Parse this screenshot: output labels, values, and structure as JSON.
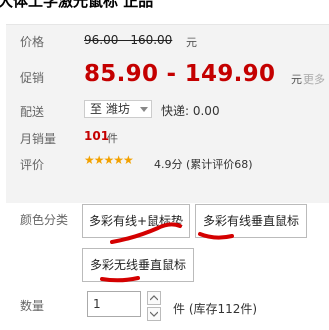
{
  "product": {
    "title": "大体工学激光鼠标 正品"
  },
  "price": {
    "label": "价格",
    "original": "96.00 - 160.00",
    "currency": "元"
  },
  "promo": {
    "label": "促销",
    "value": "85.90 - 149.90",
    "currency": "元",
    "more": "更多"
  },
  "shipping": {
    "label": "配送",
    "destination": "至 潍坊",
    "fee": "快递: 0.00"
  },
  "monthly_sales": {
    "label": "月销量",
    "value": "101",
    "unit": "件"
  },
  "rating": {
    "label": "评价",
    "stars": "★★★★★",
    "score": "4.9分",
    "count_text": "(累计评价68)",
    "star_color": "#f2a100"
  },
  "sku": {
    "label": "颜色分类",
    "options": [
      "多彩有线+鼠标垫",
      "多彩有线垂直鼠标",
      "多彩无线垂直鼠标"
    ]
  },
  "quantity": {
    "label": "数量",
    "value": "1",
    "unit": "件",
    "stock": "(库存112件)"
  },
  "colors": {
    "price_red": "#c40000",
    "annotation_red": "#d40000"
  }
}
